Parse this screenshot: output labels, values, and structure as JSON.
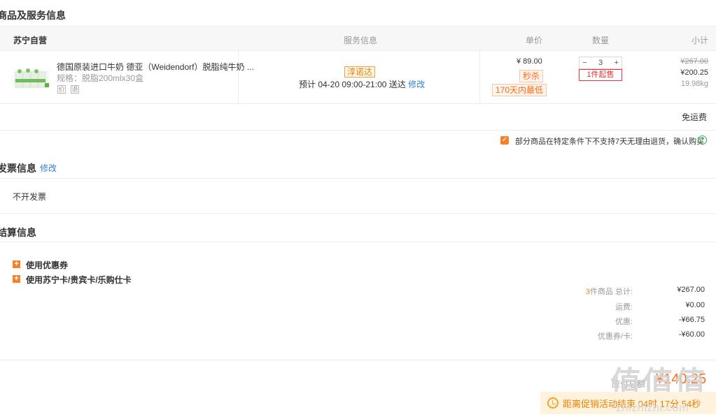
{
  "section_goods": {
    "title": "商品及服务信息"
  },
  "table_header": {
    "seller": "苏宁自营",
    "service": "服务信息",
    "unit_price": "单价",
    "quantity": "数量",
    "subtotal": "小计"
  },
  "product": {
    "name": "德国原装进口牛奶 德亚（Weidendorf）脱脂纯牛奶 ...",
    "spec": "规格：脱脂200mlx30盒",
    "tag1": "价",
    "tag2": "退",
    "service_badge": "淳诺达",
    "delivery_text": "预计 04-20  09:00-21:00  送达",
    "delivery_edit": "修改",
    "unit_price": "¥ 89.00",
    "badge_flash": "秒杀",
    "badge_lowest": "170天内最低",
    "qty_minus": "−",
    "qty_value": "3",
    "qty_plus": "+",
    "qty_limit": "1件起售",
    "orig_total": "¥267.00",
    "total": "¥200.25",
    "weight": "19.98kg"
  },
  "shipping_note": "免运费",
  "policy": {
    "check": "✓",
    "text": "部分商品在特定条件下不支持7天无理由退货，确认购买",
    "help": "?"
  },
  "invoice": {
    "title": "发票信息",
    "edit": "修改",
    "value": "不开发票"
  },
  "settlement": {
    "title": "结算信息",
    "options": [
      {
        "icon": "+",
        "label": "使用优惠券"
      },
      {
        "icon": "+",
        "label": "使用苏宁卡/贵宾卡/乐购仕卡"
      }
    ],
    "count": "3",
    "goods_total_label": "件商品 总计:",
    "goods_total": "¥267.00",
    "shipping_label": "运费:",
    "shipping": "¥0.00",
    "discount_label": "优惠:",
    "discount": "-¥66.75",
    "coupon_label": "优惠券/卡:",
    "coupon": "-¥60.00",
    "payable_label": "应付总额",
    "payable": "¥140.25"
  },
  "notice": {
    "text": "距离促销活动结束 04时 17分 54秒"
  },
  "watermark": {
    "cn": "值",
    "url": "zhizhizhi.com"
  }
}
